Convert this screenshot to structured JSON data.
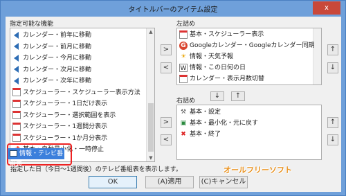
{
  "window": {
    "title": "タイトルバーのアイテム設定",
    "close_label": "x"
  },
  "available": {
    "label": "指定可能な機能",
    "items": [
      {
        "icon": "arrow-left-icon",
        "label": "カレンダー・前年に移動"
      },
      {
        "icon": "arrow-left-icon",
        "label": "カレンダー・前月に移動"
      },
      {
        "icon": "arrow-left-icon",
        "label": "カレンダー・今月に移動"
      },
      {
        "icon": "arrow-left-icon",
        "label": "カレンダー・次月に移動"
      },
      {
        "icon": "arrow-left-icon",
        "label": "カレンダー・次年に移動"
      },
      {
        "icon": "calendar-icon",
        "label": "スケジューラー・スケジューラー表示方法"
      },
      {
        "icon": "calendar-icon",
        "label": "スケジューラー・1日だけ表示"
      },
      {
        "icon": "calendar-icon",
        "label": "スケジューラー・選択範囲を表示"
      },
      {
        "icon": "calendar-icon",
        "label": "スケジューラー・1週間分表示"
      },
      {
        "icon": "calendar-icon",
        "label": "スケジューラー・1か月分表示"
      },
      {
        "icon": "pin-icon",
        "label": "基本・自動最小化・一時停止"
      }
    ],
    "selected": {
      "icon": "tv-icon",
      "label": "情報・テレビ番組表"
    }
  },
  "left_pane": {
    "label": "左詰め",
    "items": [
      {
        "icon": "calendar-icon",
        "label": "基本・スケジューラー表示"
      },
      {
        "icon": "google-icon",
        "label": "Googleカレンダー・Googleカレンダー同期"
      },
      {
        "icon": "weather-icon",
        "label": "情報・天気予報"
      },
      {
        "icon": "wiki-icon",
        "label": "情報・この日何の日"
      },
      {
        "icon": "calendar-icon",
        "label": "カレンダー・表示月数切替"
      }
    ]
  },
  "right_pane": {
    "label": "右詰め",
    "items": [
      {
        "icon": "tools-icon",
        "label": "基本・設定"
      },
      {
        "icon": "window-icon",
        "label": "基本・最小化・元に戻す"
      },
      {
        "icon": "close-x-icon",
        "label": "基本・終了"
      }
    ]
  },
  "buttons": {
    "move_right": ">",
    "move_left": "<",
    "up": "↑",
    "down": "↓",
    "ok": "OK",
    "cancel": "(A)適用",
    "apply": "(C)キャンセル"
  },
  "description": "指定した日（今日～1週間後）のテレビ番組表を表示します。",
  "watermark": "オールフリーソフト",
  "colors": {
    "accent": "#3b7fdc",
    "highlight": "#e22222",
    "titlebar": "#6fa0da"
  }
}
